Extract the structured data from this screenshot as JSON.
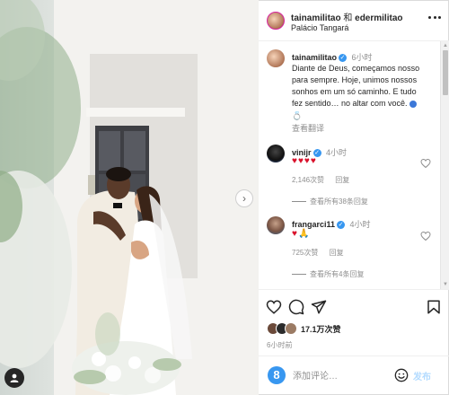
{
  "header": {
    "user1": "tainamilitao",
    "conjunction": "和",
    "user2": "edermilitao",
    "location": "Palácio Tangará"
  },
  "caption": {
    "username": "tainamilitao",
    "time": "6小时",
    "text": "Diante de Deus, começamos nosso para sempre. Hoje, unimos nossos sonhos em um só caminho. E tudo fez sentido… no altar com você.",
    "ring": "💍",
    "translate": "查看翻译"
  },
  "comments": [
    {
      "username": "vinijr",
      "time": "4小时",
      "text": "♥♥♥♥",
      "likes": "2,146次赞",
      "reply": "回复",
      "view_replies": "查看所有38条回复"
    },
    {
      "username": "frangarci11",
      "time": "4小时",
      "text": "♥",
      "likes": "725次赞",
      "reply": "回复",
      "view_replies": "查看所有4条回复"
    }
  ],
  "actions": {
    "likes": "17.1万次赞",
    "post_time": "6小时前"
  },
  "comment_box": {
    "placeholder": "添加评论…",
    "post_label": "发布"
  },
  "icons": {
    "like": "heart-outline-icon",
    "comment": "comment-icon",
    "share": "paper-plane-icon",
    "save": "bookmark-icon",
    "emoji": "smiley-icon",
    "more": "more-dots-icon"
  },
  "colors": {
    "verified_blue": "#3897f0",
    "heart_red": "#d9102a",
    "post_button": "#b3dbff"
  }
}
